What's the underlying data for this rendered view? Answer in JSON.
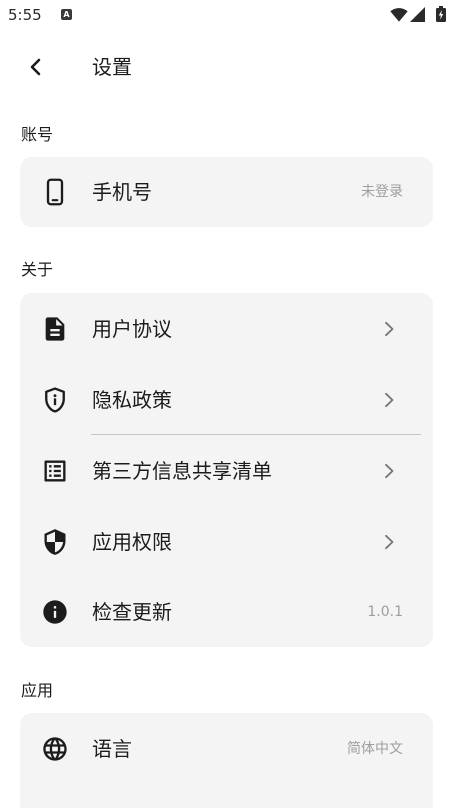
{
  "status_bar": {
    "time": "5:55",
    "notification_badge": "A",
    "icons": [
      "wifi-icon",
      "signal-icon",
      "battery-charging-icon"
    ]
  },
  "header": {
    "back_icon": "chevron-left-icon",
    "title": "设置"
  },
  "sections": [
    {
      "label": "账号",
      "items": [
        {
          "icon": "smartphone-icon",
          "label": "手机号",
          "value": "未登录"
        }
      ]
    },
    {
      "label": "关于",
      "items": [
        {
          "icon": "document-icon",
          "label": "用户协议",
          "trailing": "chevron-right-icon"
        },
        {
          "icon": "privacy-shield-icon",
          "label": "隐私政策",
          "trailing": "chevron-right-icon"
        },
        {
          "icon": "list-icon",
          "label": "第三方信息共享清单",
          "trailing": "chevron-right-icon"
        },
        {
          "icon": "security-shield-icon",
          "label": "应用权限",
          "trailing": "chevron-right-icon"
        },
        {
          "icon": "info-icon",
          "label": "检查更新",
          "value": "1.0.1"
        }
      ]
    },
    {
      "label": "应用",
      "items": [
        {
          "icon": "globe-icon",
          "label": "语言",
          "value": "简体中文"
        }
      ]
    }
  ],
  "colors": {
    "background": "#ffffff",
    "card": "#f4f4f4",
    "text": "#1c1c1c",
    "secondary_text": "#9e9e9e",
    "chevron": "#757575",
    "divider": "#c4c4c4"
  }
}
